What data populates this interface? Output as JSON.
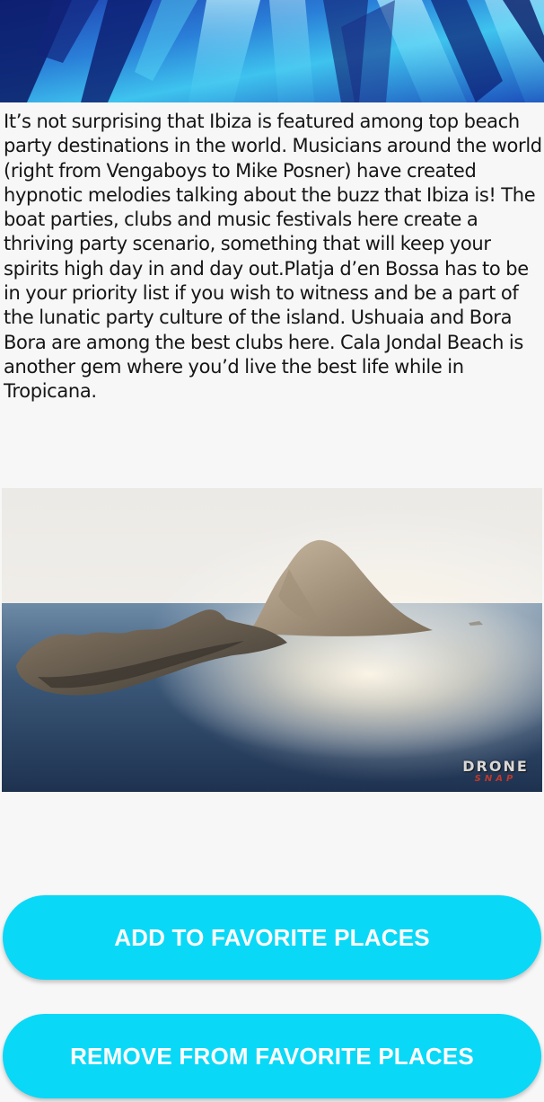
{
  "theme": {
    "background": "#f7f7f7",
    "button_color": "#0ad8f7",
    "button_text_color": "#ffffff",
    "text_color": "#151515"
  },
  "top_image": {
    "icon": "concert-light-beams-image"
  },
  "article": {
    "text": "It’s not surprising that Ibiza is featured among top beach party destinations in the world. Musicians around the world (right from Vengaboys to Mike Posner) have created hypnotic melodies talking about the buzz that Ibiza is! The boat parties, clubs and music festivals here create a thriving party scenario, something that will keep your spirits high day in and day out.Platja d’en Bossa has to be in your priority list if you wish to witness and be a part of the lunatic party culture of the island. Ushuaia and Bora Bora are among the best clubs here. Cala Jondal Beach is another gem where you’d live the best life while in Tropicana."
  },
  "island_image": {
    "icon": "island-aerial-photo",
    "watermark_main": "DRONE",
    "watermark_sub": "SNAP"
  },
  "buttons": {
    "add_label": "ADD TO FAVORITE PLACES",
    "remove_label": "REMOVE FROM FAVORITE PLACES"
  }
}
